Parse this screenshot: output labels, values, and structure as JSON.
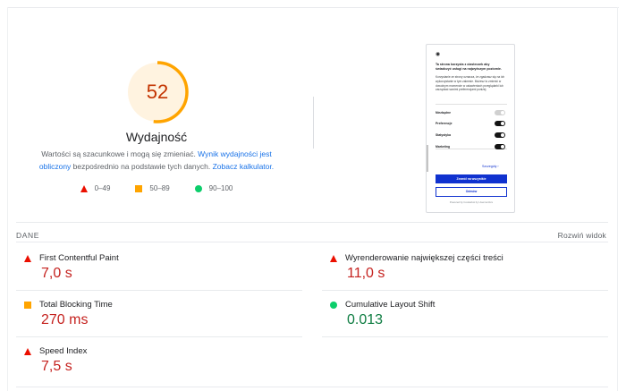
{
  "score": {
    "value": "52",
    "fraction": 0.52,
    "color": "#ffa400",
    "label": "Wydajność"
  },
  "description": {
    "part1": "Wartości są szacunkowe i mogą się zmieniać. ",
    "link1": "Wynik wydajności jest obliczony",
    "part2": " bezpośrednio na podstawie tych danych. ",
    "link2": "Zobacz kalkulator."
  },
  "legend": [
    {
      "icon": "red-triangle-icon",
      "range": "0–49",
      "color": "#eb0f00"
    },
    {
      "icon": "orange-square-icon",
      "range": "50–89",
      "color": "#ffa400"
    },
    {
      "icon": "green-circle-icon",
      "range": "90–100",
      "color": "#0cce6b"
    }
  ],
  "screenshot": {
    "title": "Ta strona korzysta z ciasteczek aby świadczyć usługi na najwyższym poziomie.",
    "body": "Korzystanie ze strony oznacza, że zgadzasz się na ich wykorzystanie w tym zakresie. Możesz to zmienić w dowolnym momencie w ustawieniach przeglądarki lub zarządzać swoimi preferencjami poniżej.",
    "rows": [
      "Niezbędne",
      "Preferencje",
      "Statystyka",
      "Marketing"
    ],
    "details": "Szczegóły",
    "allow": "Zezwól na wszystkie",
    "deny": "Odmów",
    "footer": "Powered by Cookiebot by Usercentrics"
  },
  "section": {
    "title": "DANE",
    "expand": "Rozwiń widok"
  },
  "metrics": [
    {
      "name": "First Contentful Paint",
      "value": "7,0 s",
      "status": "poor"
    },
    {
      "name": "Wyrenderowanie największej części treści",
      "value": "11,0 s",
      "status": "poor"
    },
    {
      "name": "Total Blocking Time",
      "value": "270 ms",
      "status": "average"
    },
    {
      "name": "Cumulative Layout Shift",
      "value": "0.013",
      "status": "good"
    },
    {
      "name": "Speed Index",
      "value": "7,5 s",
      "status": "poor"
    }
  ]
}
